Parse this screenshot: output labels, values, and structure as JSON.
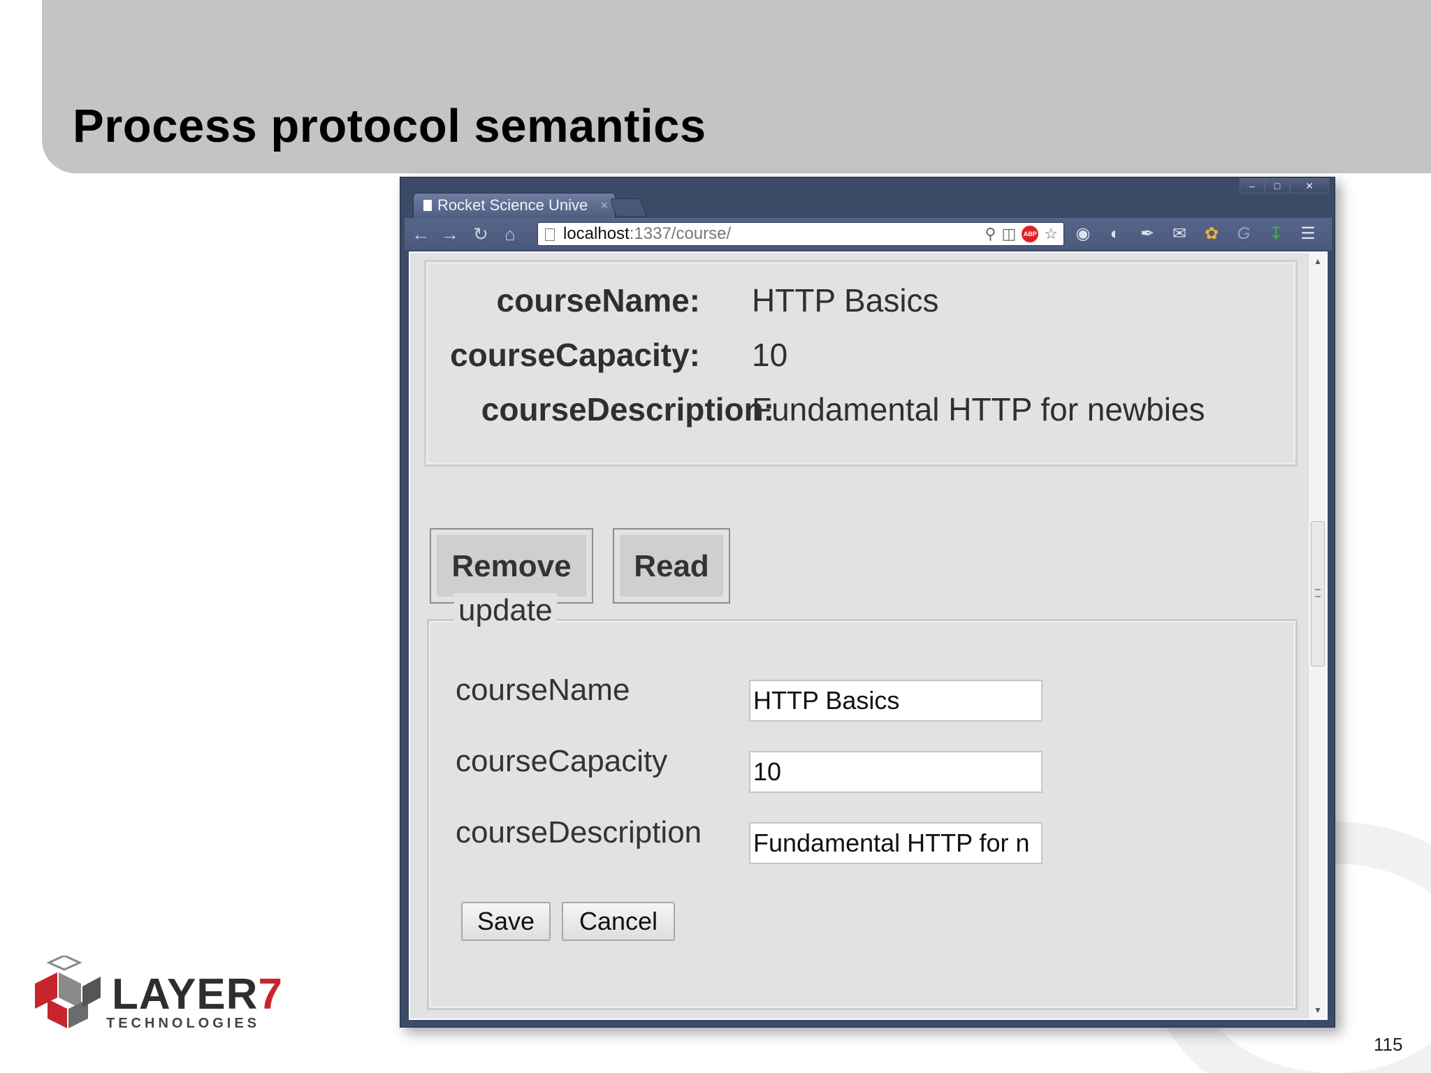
{
  "slide": {
    "title": "Process protocol semantics",
    "page_number": "115",
    "logo": {
      "word": "LAYER",
      "number": "7",
      "subtitle": "TECHNOLOGIES"
    }
  },
  "browser": {
    "tab_title": "Rocket Science Unive",
    "url_host": "localhost",
    "url_path": ":1337/course/",
    "icons": [
      "back-icon",
      "forward-icon",
      "reload-icon",
      "home-icon",
      "zoom-icon",
      "page-icon",
      "adblock-icon",
      "star-icon",
      "color-picker-icon",
      "globe-clock-icon",
      "eyedropper-icon",
      "notification-icon",
      "pawprint-icon",
      "g-icon",
      "download-icon",
      "menu-icon"
    ]
  },
  "course_detail": {
    "rows": [
      {
        "label": "courseName:",
        "value": "HTTP Basics"
      },
      {
        "label": "courseCapacity:",
        "value": "10"
      },
      {
        "label": "courseDescription:",
        "value": "Fundamental HTTP for newbies"
      }
    ]
  },
  "actions": {
    "remove_label": "Remove",
    "read_label": "Read"
  },
  "update_form": {
    "legend": "update",
    "fields": [
      {
        "label": "courseName",
        "value": "HTTP Basics"
      },
      {
        "label": "courseCapacity",
        "value": "10"
      },
      {
        "label": "courseDescription",
        "value": "Fundamental HTTP for n"
      }
    ],
    "save_label": "Save",
    "cancel_label": "Cancel"
  },
  "colors": {
    "header_band": "#c4c4c4",
    "window_frame": "#3b4a66",
    "page_background": "#e2e2e2",
    "logo_accent": "#c8242b"
  }
}
